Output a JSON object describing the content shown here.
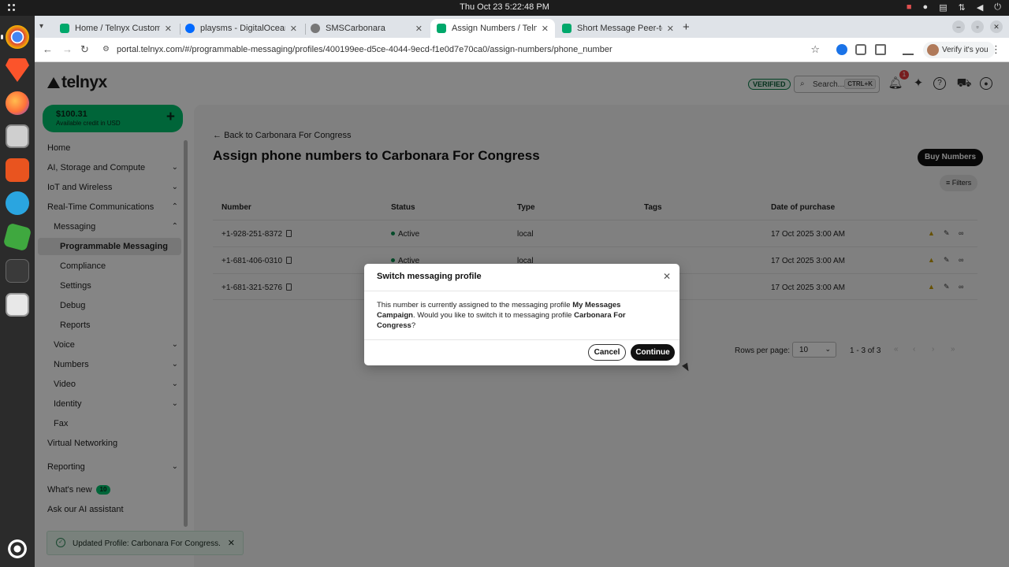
{
  "os": {
    "clock": "Thu Oct 23   5:22:48 PM"
  },
  "browser": {
    "tabs": [
      {
        "label": "Home / Telnyx Customer",
        "favicon": "telnyx-icon"
      },
      {
        "label": "playsms - DigitalOcean",
        "favicon": "digitalocean-icon"
      },
      {
        "label": "SMSCarbonara",
        "favicon": "globe-icon"
      },
      {
        "label": "Assign Numbers / Telnyx",
        "favicon": "telnyx-icon"
      },
      {
        "label": "Short Message Peer-to-P",
        "favicon": "telnyx-icon"
      }
    ],
    "url": "portal.telnyx.com/#/programmable-messaging/profiles/400199ee-d5ce-4044-9ecd-f1e0d7e70ca0/assign-numbers/phone_number",
    "verify_label": "Verify it's you"
  },
  "header": {
    "logo": "telnyx",
    "verified": "VERIFIED",
    "search_placeholder": "Search...",
    "search_shortcut": "CTRL+K",
    "notifications_count": "1"
  },
  "credit": {
    "amount": "$100.31",
    "sub": "Available credit in USD"
  },
  "sidebar": {
    "items": [
      {
        "label": "Home"
      },
      {
        "label": "AI, Storage and Compute"
      },
      {
        "label": "IoT and Wireless"
      },
      {
        "label": "Real-Time Communications"
      },
      {
        "label": "Messaging"
      },
      {
        "label": "Programmable Messaging"
      },
      {
        "label": "Compliance"
      },
      {
        "label": "Settings"
      },
      {
        "label": "Debug"
      },
      {
        "label": "Reports"
      },
      {
        "label": "Voice"
      },
      {
        "label": "Numbers"
      },
      {
        "label": "Video"
      },
      {
        "label": "Identity"
      },
      {
        "label": "Fax"
      },
      {
        "label": "Virtual Networking"
      },
      {
        "label": "Reporting"
      },
      {
        "label": "What's new",
        "badge": "10"
      },
      {
        "label": "Ask our AI assistant"
      }
    ]
  },
  "main": {
    "back_link": "Back to Carbonara For Congress",
    "title": "Assign phone numbers to Carbonara For Congress",
    "buy_button": "Buy Numbers",
    "filters_button": "Filters",
    "table": {
      "headers": [
        "Number",
        "Status",
        "Type",
        "Tags",
        "Date of purchase"
      ],
      "rows": [
        {
          "number": "+1-928-251-8372",
          "status": "Active",
          "type": "local",
          "tags": "",
          "date": "17 Oct 2025 3:00 AM"
        },
        {
          "number": "+1-681-406-0310",
          "status": "Active",
          "type": "local",
          "tags": "",
          "date": "17 Oct 2025 3:00 AM"
        },
        {
          "number": "+1-681-321-5276",
          "status": "",
          "type": "",
          "tags": "",
          "date": "17 Oct 2025 3:00 AM"
        }
      ]
    },
    "pagination": {
      "rows_per_page_label": "Rows per page:",
      "rows_per_page": "10",
      "range": "1 - 3 of 3"
    }
  },
  "modal": {
    "title": "Switch messaging profile",
    "body_pre": "This number is currently assigned to the messaging profile ",
    "current_profile": "My Messages Campaign",
    "body_mid": ". Would you like to switch it to messaging profile ",
    "target_profile": "Carbonara For Congress",
    "body_post": "?",
    "cancel": "Cancel",
    "continue": "Continue"
  },
  "toast": {
    "message": "Updated Profile: Carbonara For Congress."
  },
  "colors": {
    "brand_green": "#00c26e",
    "status_active": "#0a8f4f",
    "primary_button": "#111111"
  }
}
